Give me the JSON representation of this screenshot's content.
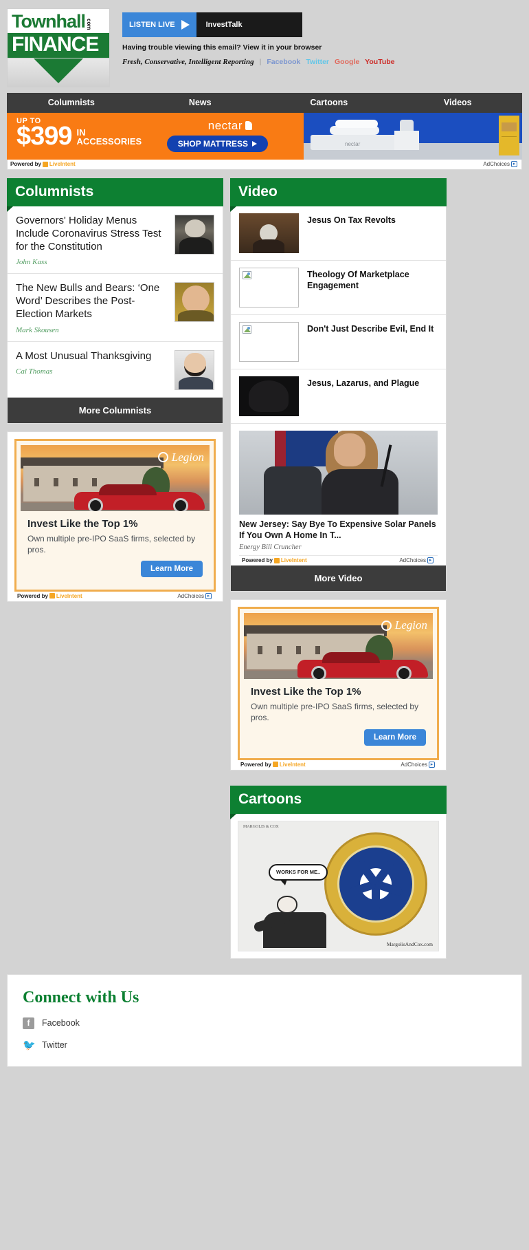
{
  "brand": {
    "logo_top": "Townhall",
    "logo_com": "com",
    "logo_bottom": "FINANCE"
  },
  "header": {
    "listen_live_label": "LISTEN LIVE",
    "show_name": "InvestTalk",
    "trouble_text": "Having trouble viewing this email? View it in your browser",
    "tagline": "Fresh, Conservative, Intelligent Reporting",
    "divider": "|",
    "social": [
      {
        "label": "Facebook"
      },
      {
        "label": "Twitter"
      },
      {
        "label": "Google"
      },
      {
        "label": "YouTube"
      }
    ]
  },
  "nav": {
    "items": [
      {
        "label": "Columnists"
      },
      {
        "label": "News"
      },
      {
        "label": "Cartoons"
      },
      {
        "label": "Videos"
      }
    ]
  },
  "top_ad": {
    "upto": "UP TO",
    "price": "$399",
    "in_label": "IN",
    "accessories_label": "ACCESSORIES",
    "brand": "nectar",
    "cta": "SHOP MATTRESS",
    "brand_small": "nectar",
    "powered_by": "Powered by",
    "network": "LiveIntent",
    "adchoices": "AdChoices"
  },
  "columnists": {
    "heading": "Columnists",
    "stories": [
      {
        "title": "Governors' Holiday Menus Include Coronavirus Stress Test for the Constitution",
        "author": "John Kass"
      },
      {
        "title": "The New Bulls and Bears: ‘One Word’ Describes the Post-Election Markets",
        "author": "Mark Skousen"
      },
      {
        "title": "A Most Unusual Thanksgiving",
        "author": "Cal Thomas"
      }
    ],
    "more_label": "More Columnists"
  },
  "legion_ad": {
    "logo": "Legion",
    "headline": "Invest Like the Top 1%",
    "body": "Own multiple pre-IPO SaaS firms, selected by pros.",
    "cta": "Learn More",
    "powered_by": "Powered by",
    "network": "LiveIntent",
    "adchoices": "AdChoices"
  },
  "video": {
    "heading": "Video",
    "items": [
      {
        "title": "Jesus On Tax Revolts"
      },
      {
        "title": "Theology Of Marketplace Engagement"
      },
      {
        "title": "Don't Just Describe Evil, End It"
      },
      {
        "title": "Jesus, Lazarus, and Plague"
      }
    ],
    "sponsored": {
      "title": "New Jersey: Say Bye To Expensive Solar Panels If You Own A Home In T...",
      "source": "Energy Bill Cruncher",
      "powered_by": "Powered by",
      "network": "LiveIntent",
      "adchoices": "AdChoices"
    },
    "more_label": "More Video"
  },
  "cartoons": {
    "heading": "Cartoons",
    "bubble_text": "WORKS FOR ME..",
    "seal_text": "SEAL OF THE PRESIDENT OF THE UNITED STATES",
    "signature": "MargolisAndCox.com",
    "top_tag": "MARGOLIS & COX"
  },
  "footer": {
    "heading": "Connect with Us",
    "links": [
      {
        "label": "Facebook",
        "icon": "facebook-icon",
        "glyph": "f"
      },
      {
        "label": "Twitter",
        "icon": "twitter-icon",
        "glyph": "✉"
      }
    ]
  }
}
